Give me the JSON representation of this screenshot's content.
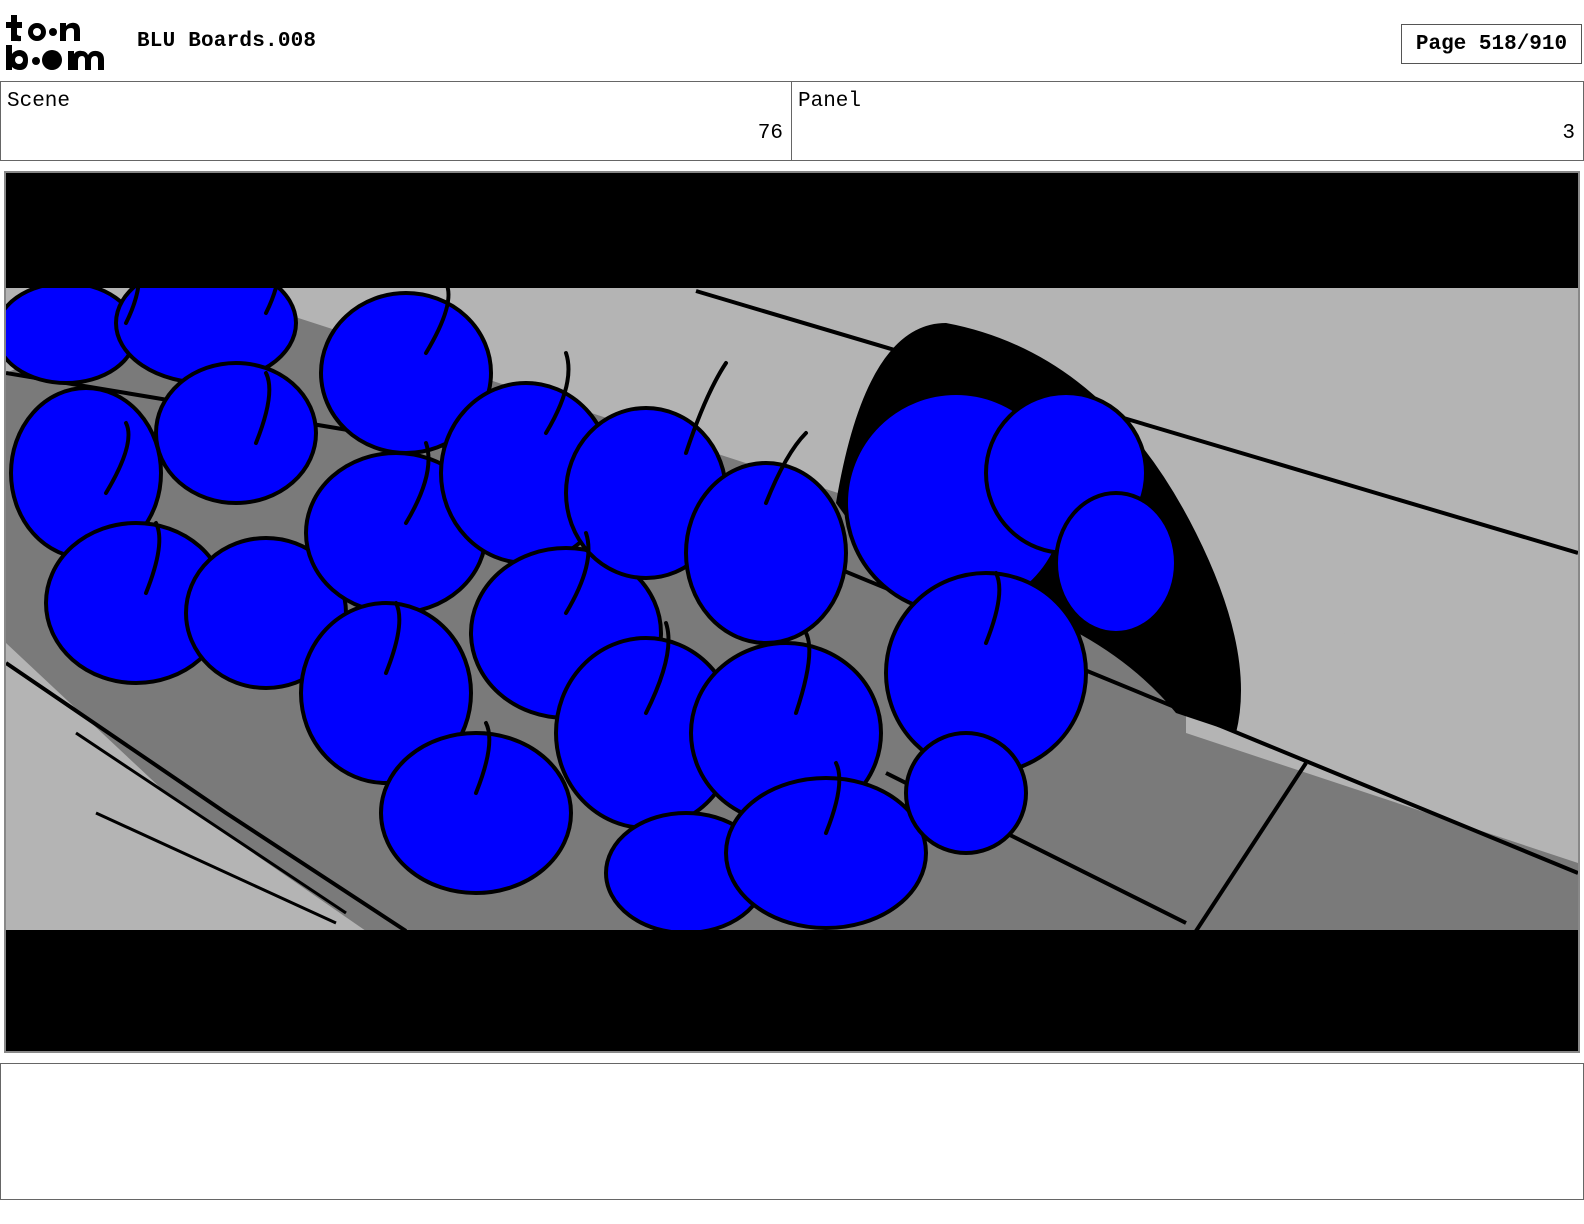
{
  "header": {
    "logo_text": "toonboom",
    "document_title": "BLU Boards.008",
    "page_indicator": "Page 518/910"
  },
  "info": {
    "scene_label": "Scene",
    "scene_value": "76",
    "panel_label": "Panel",
    "panel_value": "3"
  },
  "frame": {
    "description_colors": {
      "crowd": "#0000ff",
      "floor_light": "#b4b4b4",
      "floor_dark": "#7a7a7a",
      "letterbox": "#000000"
    }
  },
  "notes": {
    "text": ""
  }
}
